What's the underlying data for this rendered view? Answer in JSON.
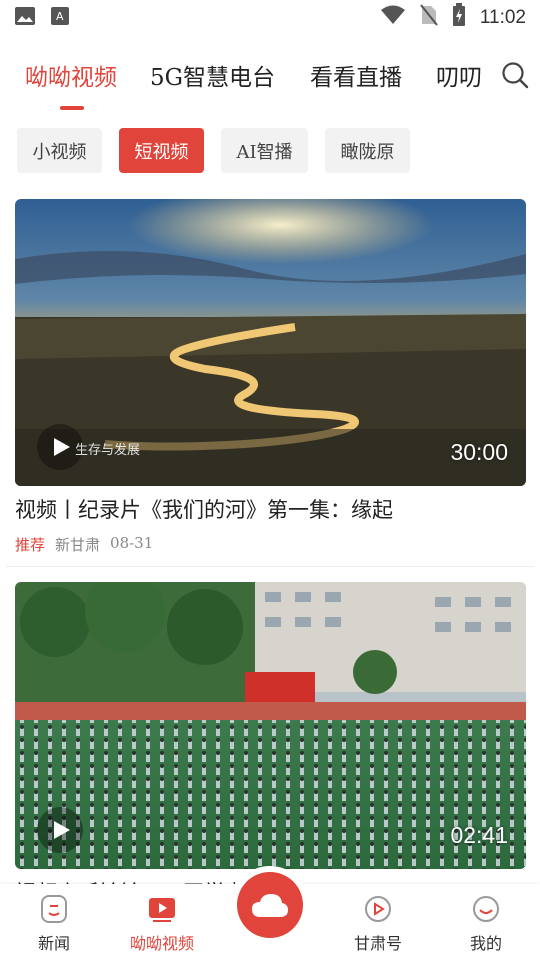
{
  "status_bar": {
    "time": "11:02",
    "icons": [
      "image-icon",
      "font-icon",
      "wifi-icon",
      "no-sim-icon",
      "battery-charging-icon"
    ]
  },
  "top_tabs": {
    "items": [
      {
        "label": "呦呦视频",
        "active": true
      },
      {
        "label": "5G智慧电台",
        "active": false
      },
      {
        "label": "看看直播",
        "active": false
      },
      {
        "label": "叨叨",
        "active": false
      }
    ],
    "search_icon": "search-icon"
  },
  "sub_tabs": {
    "items": [
      {
        "label": "小视频",
        "active": false
      },
      {
        "label": "短视频",
        "active": true
      },
      {
        "label": "AI智播",
        "active": false
      },
      {
        "label": "瞰陇原",
        "active": false
      }
    ]
  },
  "videos": [
    {
      "duration": "30:00",
      "watermark": "生存与发展",
      "title": "视频丨纪录片《我们的河》第一集：缘起",
      "tag": "推荐",
      "source": "新甘肃",
      "date": "08-31"
    },
    {
      "duration": "02:41",
      "title": "视频丨听铃铃……开学啦！",
      "tag": "",
      "source": "",
      "date": ""
    }
  ],
  "bottom_nav": {
    "items": [
      {
        "label": "新闻",
        "icon": "news-icon",
        "active": false
      },
      {
        "label": "呦呦视频",
        "icon": "video-play-icon",
        "active": true
      },
      {
        "label": "甘肃号",
        "icon": "play-circle-icon",
        "active": false
      },
      {
        "label": "我的",
        "icon": "profile-icon",
        "active": false
      }
    ],
    "center_icon": "cloud-icon"
  },
  "colors": {
    "accent": "#e0443b",
    "chip_bg": "#f2f2f2",
    "meta_gray": "#888888"
  }
}
